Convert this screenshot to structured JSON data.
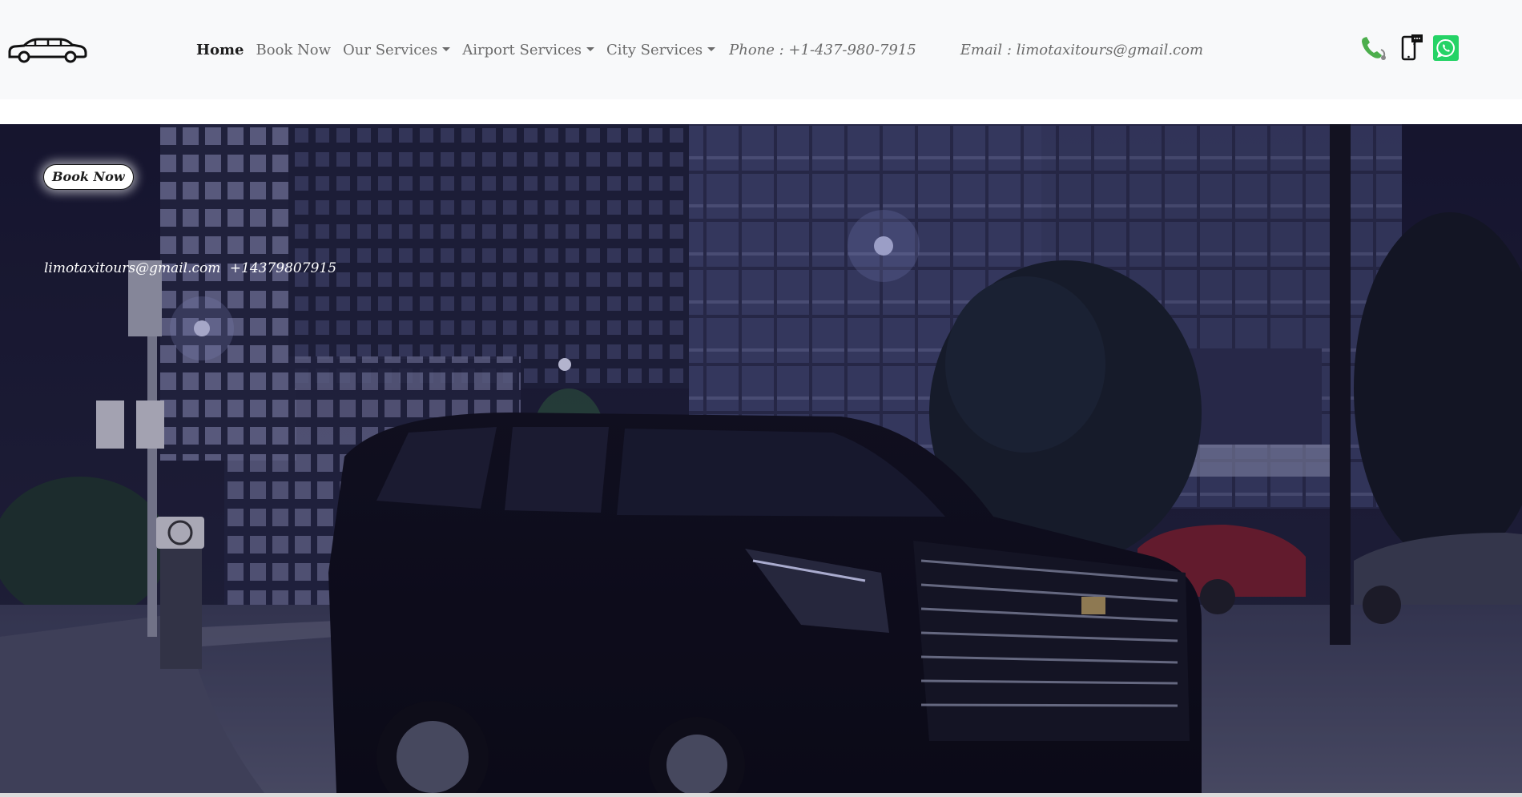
{
  "navbar": {
    "logo_icon": "limousine-icon",
    "links": [
      {
        "label": "Home",
        "active": true,
        "dropdown": false
      },
      {
        "label": "Book Now",
        "active": false,
        "dropdown": false
      },
      {
        "label": "Our Services",
        "active": false,
        "dropdown": true
      },
      {
        "label": "Airport Services",
        "active": false,
        "dropdown": true
      },
      {
        "label": "City Services",
        "active": false,
        "dropdown": true
      }
    ],
    "phone": "Phone : +1-437-980-7915",
    "email": "Email : limotaxitours@gmail.com",
    "icons": [
      "phone-icon",
      "mobile-sms-icon",
      "whatsapp-icon"
    ]
  },
  "hero": {
    "book_button": "Book Now",
    "email": "limotaxitours@gmail.com",
    "phone": "+14379807915",
    "background": "night-city-street-black-suv"
  },
  "colors": {
    "navbar_bg": "#f8f9fa",
    "nav_text": "#6b6b6b",
    "nav_active": "#1e1e1e",
    "phone_green": "#4cae4c",
    "whatsapp_green": "#25d366"
  }
}
